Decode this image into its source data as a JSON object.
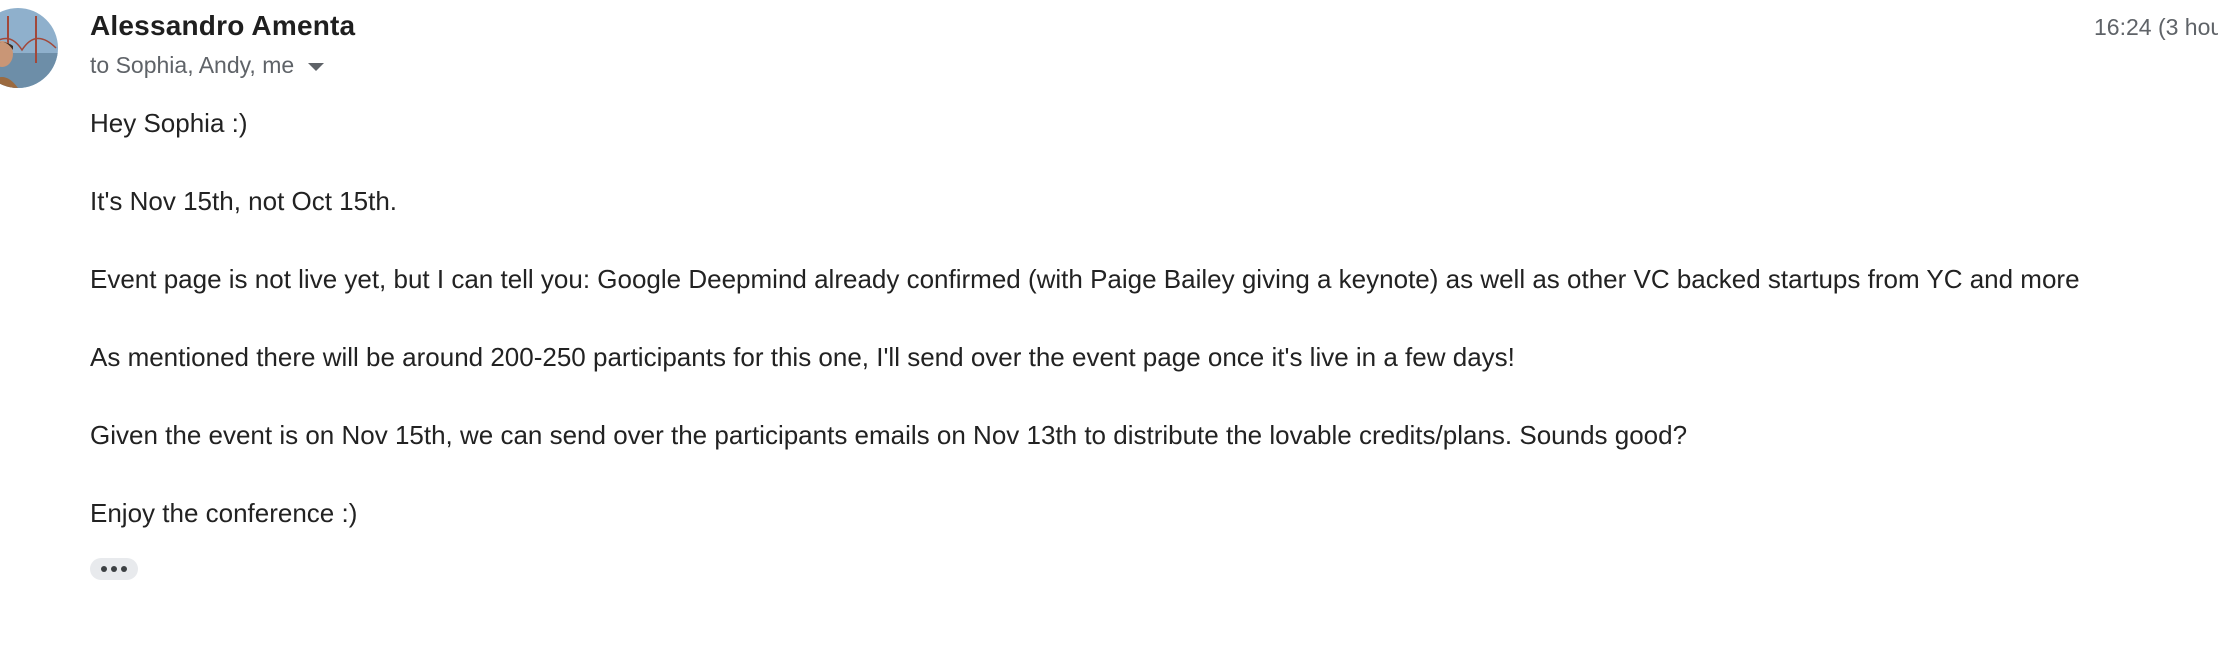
{
  "email": {
    "sender_name": "Alessandro Amenta",
    "recipients": "to Sophia, Andy, me",
    "timestamp": "16:24 (3 hou",
    "avatar_icon": "user-avatar-photo",
    "dropdown_icon": "caret-down-icon",
    "body": [
      "Hey Sophia :)",
      "It's Nov 15th, not Oct 15th.",
      "Event page is not live yet, but I can tell you: Google Deepmind already confirmed (with Paige Bailey giving a keynote) as well as other VC backed startups from YC and more",
      "As mentioned there will be around 200-250 participants for this one, I'll send over the event page once it's live in a few days!",
      "Given the event is on Nov 15th, we can send over the participants emails on Nov 13th to distribute the lovable credits/plans. Sounds good?",
      "Enjoy the conference :)"
    ],
    "trimmed_content_icon": "more-horizontal-icon"
  },
  "colors": {
    "sender": "#1f1f1f",
    "secondary_text": "#5f6368",
    "body_text": "#222222",
    "toggle_bg": "#e8eaed"
  }
}
